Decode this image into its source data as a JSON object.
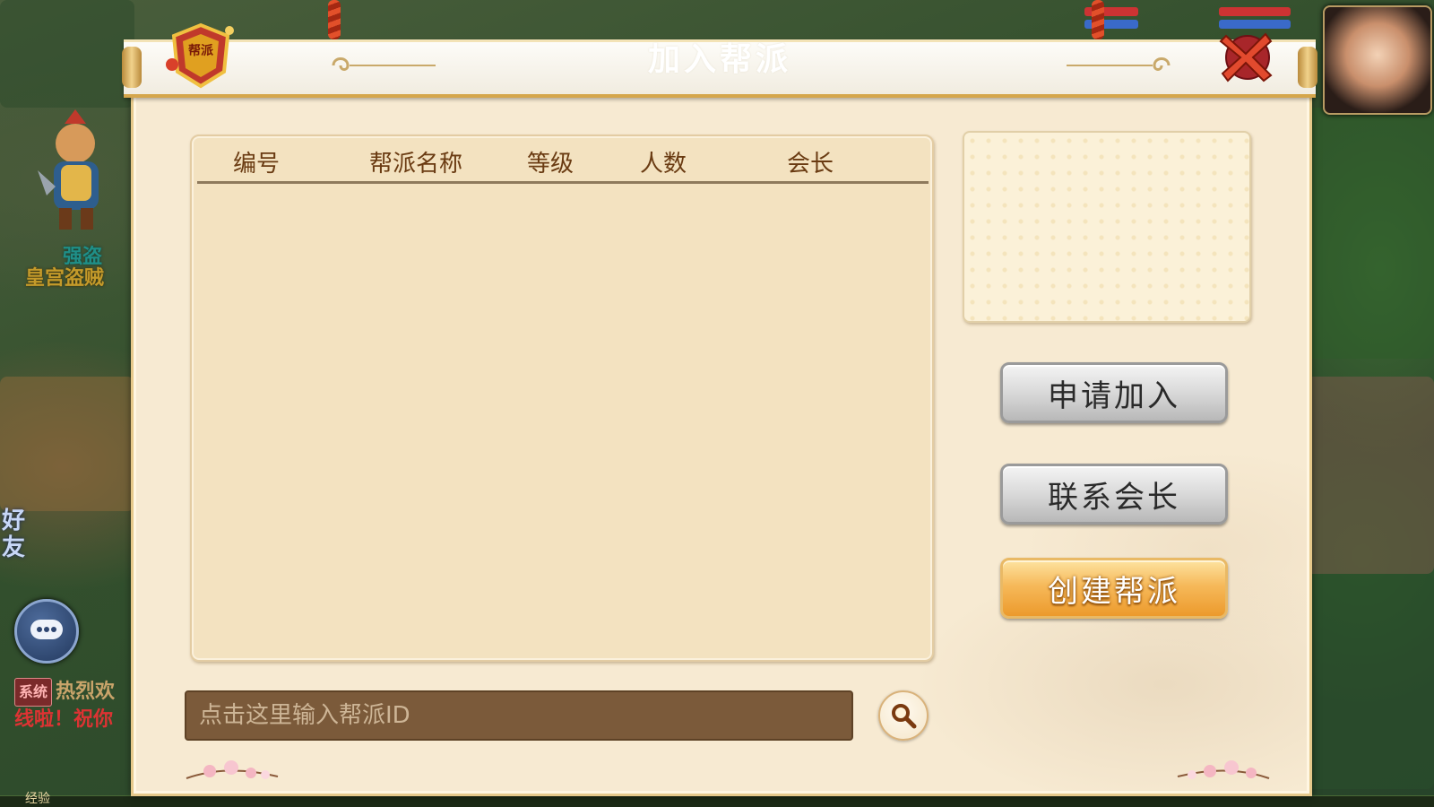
{
  "dialog": {
    "title": "加入帮派",
    "emblem_text": "帮派",
    "table": {
      "columns": [
        "编号",
        "帮派名称",
        "等级",
        "人数",
        "会长"
      ],
      "rows": []
    },
    "buttons": {
      "apply": "申请加入",
      "contact": "联系会长",
      "create": "创建帮派"
    },
    "search": {
      "placeholder": "点击这里输入帮派ID",
      "value": ""
    }
  },
  "world": {
    "npc_name": "强盗",
    "npc_title": "皇宫盗贼",
    "friend_label": "好友",
    "chat_tag": "系统",
    "chat_line1": "热烈欢",
    "chat_line2": "线啦！祝你",
    "exp_label": "经验"
  },
  "colors": {
    "accent_orange": "#ec9a2c",
    "header_text": "#6a3b12",
    "panel_bg": "#f3e2c0",
    "search_bg": "#7b5a3a"
  },
  "icons": [
    "guild-emblem-icon",
    "close-icon",
    "search-icon",
    "chat-bubble-icon",
    "flower-icon"
  ]
}
